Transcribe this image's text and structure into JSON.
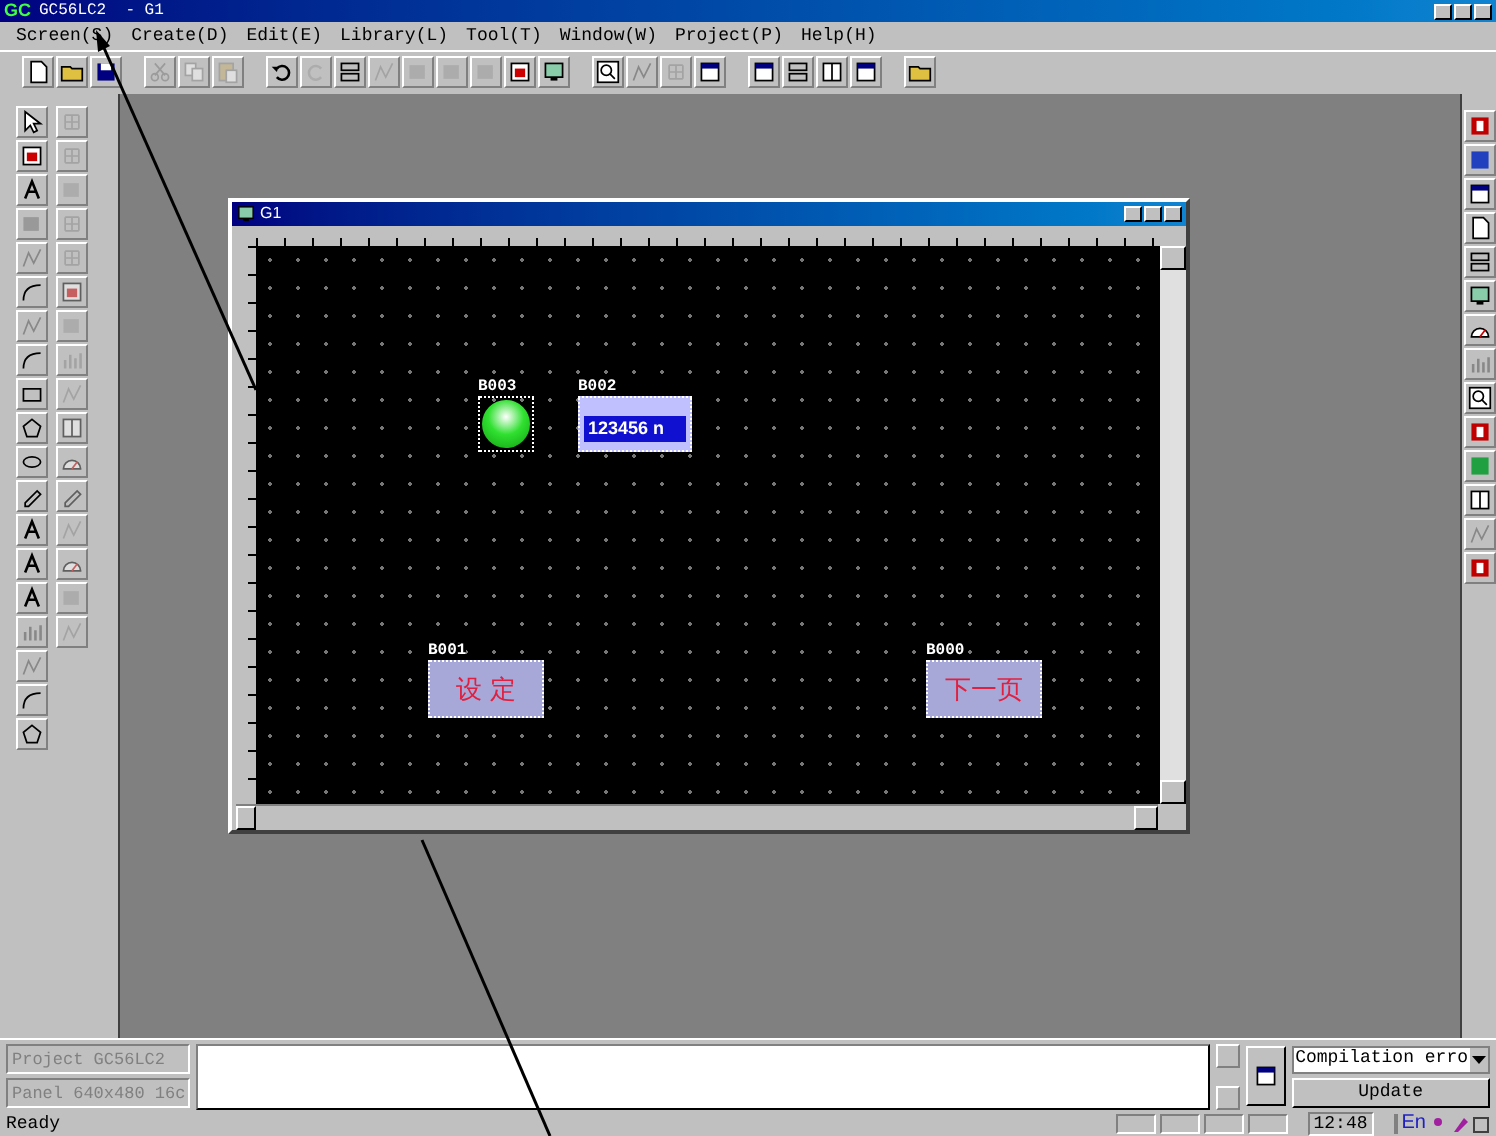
{
  "window": {
    "logo": "GC",
    "title": "GC56LC2  - G1"
  },
  "menu": [
    "Screen(S)",
    "Create(D)",
    "Edit(E)",
    "Library(L)",
    "Tool(T)",
    "Window(W)",
    "Project(P)",
    "Help(H)"
  ],
  "child_window": {
    "title": "G1",
    "objects": [
      {
        "kind": "lamp",
        "tag": "B003"
      },
      {
        "kind": "numeric",
        "tag": "B002",
        "value": "123456 n"
      },
      {
        "kind": "button",
        "tag": "B001",
        "label": "设 定"
      },
      {
        "kind": "button",
        "tag": "B000",
        "label": "下一页"
      }
    ]
  },
  "output_panel": {
    "project": "Project GC56LC2",
    "panel": "Panel 640x480 16c",
    "dropdown": "Compilation erro",
    "update_button": "Update"
  },
  "status_bar": {
    "text": "Ready",
    "time": "12:48",
    "language": "En"
  }
}
